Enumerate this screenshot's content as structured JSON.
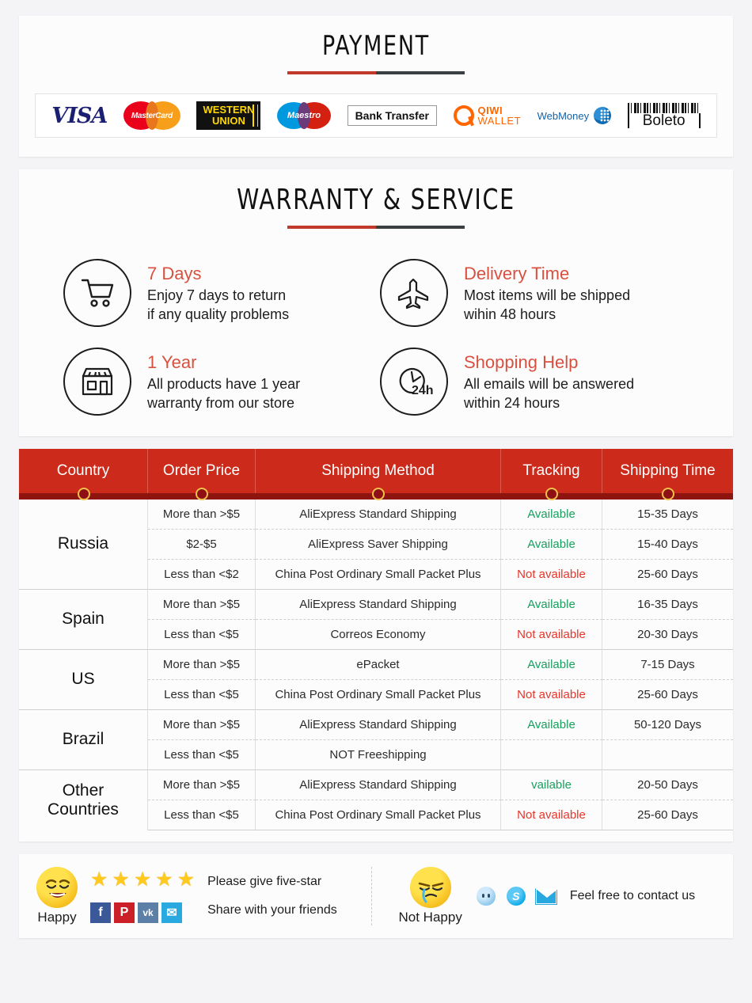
{
  "theme": {
    "page_bg": "#f4f4f6",
    "card_bg": "#fcfcfc",
    "accent_red": "#c0392b",
    "accent_dark": "#3a3f41",
    "table_header_red": "#cc2a1a",
    "table_band_maroon": "#8e1410",
    "available_green": "#17a05e",
    "not_available_red": "#e8352a"
  },
  "payment": {
    "title": "PAYMENT",
    "methods": [
      {
        "name": "visa",
        "label": "VISA"
      },
      {
        "name": "mastercard",
        "label": "MasterCard"
      },
      {
        "name": "western-union",
        "label_top": "WESTERN",
        "label_bottom": "UNION"
      },
      {
        "name": "maestro",
        "label": "Maestro"
      },
      {
        "name": "bank-transfer",
        "label": "Bank Transfer"
      },
      {
        "name": "qiwi-wallet",
        "label_top": "QIWI",
        "label_bottom": "WALLET"
      },
      {
        "name": "webmoney",
        "label": "WebMoney"
      },
      {
        "name": "boleto",
        "label": "Boleto"
      }
    ]
  },
  "warranty": {
    "title": "WARRANTY & SERVICE",
    "features": [
      {
        "icon": "shopping-cart-icon",
        "title": "7 Days",
        "line1": "Enjoy 7 days to return",
        "line2": "if any quality problems"
      },
      {
        "icon": "airplane-icon",
        "title": "Delivery Time",
        "line1": "Most items will be shipped",
        "line2": "wihin 48 hours"
      },
      {
        "icon": "storefront-icon",
        "title": "1 Year",
        "line1": "All products have 1 year",
        "line2": "warranty from our store"
      },
      {
        "icon": "clock-24h-icon",
        "title": "Shopping Help",
        "line1": "All emails will be answered",
        "line2": "within 24 hours"
      }
    ]
  },
  "shipping_table": {
    "columns": [
      "Country",
      "Order Price",
      "Shipping Method",
      "Tracking",
      "Shipping Time"
    ],
    "groups": [
      {
        "country": "Russia",
        "rows": [
          {
            "price": "More than >$5",
            "method": "AliExpress Standard Shipping",
            "tracking": "Available",
            "tracking_state": "available",
            "time": "15-35 Days"
          },
          {
            "price": "$2-$5",
            "method": "AliExpress Saver Shipping",
            "tracking": "Available",
            "tracking_state": "available",
            "time": "15-40 Days"
          },
          {
            "price": "Less than <$2",
            "method": "China Post Ordinary Small Packet Plus",
            "tracking": "Not available",
            "tracking_state": "not-available",
            "time": "25-60 Days"
          }
        ]
      },
      {
        "country": "Spain",
        "rows": [
          {
            "price": "More than >$5",
            "method": "AliExpress Standard Shipping",
            "tracking": "Available",
            "tracking_state": "available",
            "time": "16-35 Days"
          },
          {
            "price": "Less than <$5",
            "method": "Correos Economy",
            "tracking": "Not available",
            "tracking_state": "not-available",
            "time": "20-30 Days"
          }
        ]
      },
      {
        "country": "US",
        "rows": [
          {
            "price": "More than >$5",
            "method": "ePacket",
            "tracking": "Available",
            "tracking_state": "available",
            "time": "7-15 Days"
          },
          {
            "price": "Less than <$5",
            "method": "China Post Ordinary Small Packet Plus",
            "tracking": "Not available",
            "tracking_state": "not-available",
            "time": "25-60 Days"
          }
        ]
      },
      {
        "country": "Brazil",
        "rows": [
          {
            "price": "More than >$5",
            "method": "AliExpress Standard Shipping",
            "tracking": "Available",
            "tracking_state": "available",
            "time": "50-120 Days"
          },
          {
            "price": "Less than <$5",
            "method": "NOT Freeshipping",
            "tracking": "",
            "tracking_state": "none",
            "time": ""
          }
        ]
      },
      {
        "country": "Other Countries",
        "rows": [
          {
            "price": "More than >$5",
            "method": "AliExpress Standard Shipping",
            "tracking": "vailable",
            "tracking_state": "available",
            "time": "20-50 Days"
          },
          {
            "price": "Less than <$5",
            "method": "China Post Ordinary Small Packet Plus",
            "tracking": "Not available",
            "tracking_state": "not-available",
            "time": "25-60 Days"
          }
        ]
      }
    ]
  },
  "feedback": {
    "happy": {
      "emoji_label": "Happy",
      "stars": 5,
      "star_glyph": "★",
      "line1": "Please give five-star",
      "line2": "Share with your friends",
      "socials": [
        {
          "name": "facebook-icon",
          "glyph": "f"
        },
        {
          "name": "pinterest-icon",
          "glyph": "P"
        },
        {
          "name": "vk-icon",
          "glyph": "vk"
        },
        {
          "name": "twitter-icon",
          "glyph": "✉"
        }
      ]
    },
    "not_happy": {
      "emoji_label": "Not Happy",
      "contact_text": "Feel free to contact us",
      "contact_icons": [
        {
          "name": "messenger-icon"
        },
        {
          "name": "skype-icon",
          "glyph": "S"
        },
        {
          "name": "email-icon"
        }
      ]
    }
  }
}
